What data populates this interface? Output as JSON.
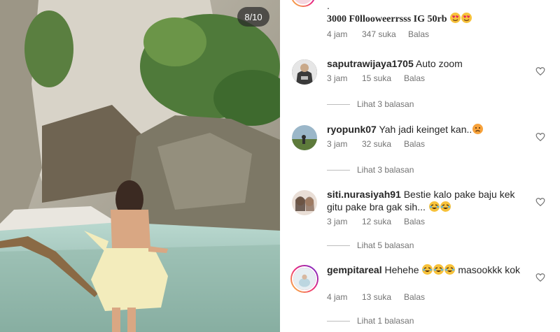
{
  "photo": {
    "counter": "8/10"
  },
  "top_comment": {
    "dot": ".",
    "text": "3000 F0llooweerrsss IG 50rb",
    "emojis": [
      "heart-eyes",
      "heart-eyes"
    ],
    "time": "4 jam",
    "likes": "347 suka",
    "reply": "Balas"
  },
  "comments": [
    {
      "username": "saputrawijaya1705",
      "text": "Auto zoom",
      "emojis": [],
      "time": "3 jam",
      "likes": "15 suka",
      "reply": "Balas",
      "view_replies": "Lihat 3 balasan"
    },
    {
      "username": "ryopunk07",
      "text": "Yah jadi keinget kan..",
      "emojis": [
        "worried"
      ],
      "time": "3 jam",
      "likes": "32 suka",
      "reply": "Balas",
      "view_replies": "Lihat 3 balasan"
    },
    {
      "username": "siti.nurasiyah91",
      "text": "Bestie kalo pake baju kek gitu pake bra gak sih...",
      "emojis": [
        "laughing",
        "laughing"
      ],
      "time": "3 jam",
      "likes": "12 suka",
      "reply": "Balas",
      "view_replies": "Lihat 5 balasan"
    },
    {
      "username": "gempitareal",
      "text": "Hehehe",
      "text_after": "masookkk kok",
      "emojis": [
        "laughing",
        "laughing",
        "laughing"
      ],
      "time": "4 jam",
      "likes": "13 suka",
      "reply": "Balas",
      "view_replies": "Lihat 1 balasan"
    }
  ],
  "colors": {
    "secondary_text": "#737373",
    "emoji_yellow": "#f7c23b"
  }
}
